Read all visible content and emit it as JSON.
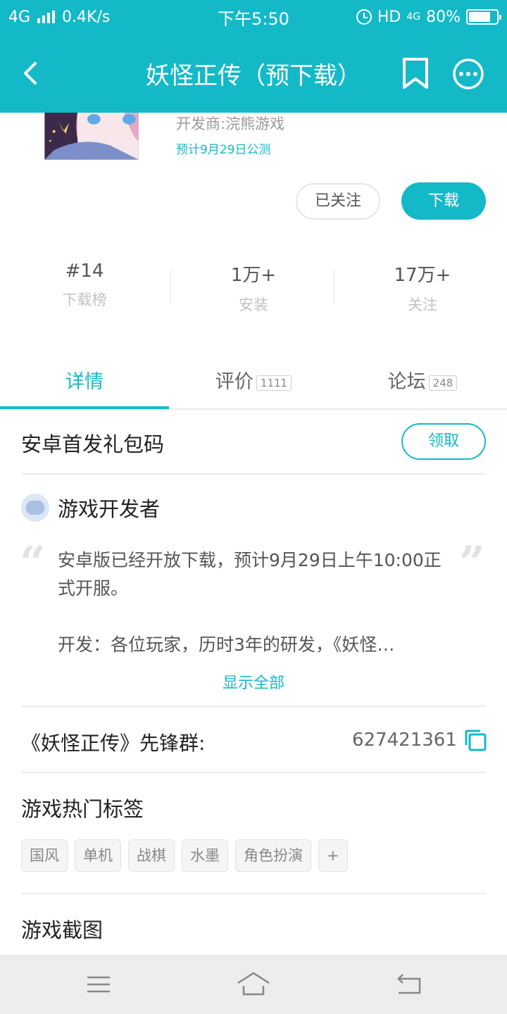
{
  "status_bar": {
    "network": "4G",
    "speed": "0.4K/s",
    "time": "下午5:50",
    "hd": "HD",
    "net2": "4G",
    "battery": "80%",
    "battery_level": 0.8
  },
  "header": {
    "title": "妖怪正传（预下载）",
    "icons": [
      "back-arrow-icon",
      "bookmark-icon",
      "more-icon"
    ]
  },
  "app": {
    "developer": "开发商:浣熊游戏",
    "release": "预计9月29日公测",
    "follow_label": "已关注",
    "download_label": "下载"
  },
  "stats": [
    {
      "value": "#14",
      "label": "下载榜"
    },
    {
      "value": "1万+",
      "label": "安装"
    },
    {
      "value": "17万+",
      "label": "关注"
    }
  ],
  "tabs": [
    {
      "label": "详情",
      "badge": ""
    },
    {
      "label": "评价",
      "badge": "1111"
    },
    {
      "label": "论坛",
      "badge": "248"
    }
  ],
  "gift": {
    "title": "安卓首发礼包码",
    "button": "领取"
  },
  "developer_note": {
    "title": "游戏开发者",
    "line1": "安卓版已经开放下载，预计9月29日上午10:00正式开服。",
    "line2": "开发：各位玩家，历时3年的研发，《妖怪…",
    "show_all": "显示全部"
  },
  "group": {
    "label": "《妖怪正传》先锋群:",
    "number": "627421361"
  },
  "tags_section": {
    "title": "游戏热门标签",
    "tags": [
      "国风",
      "单机",
      "战棋",
      "水墨",
      "角色扮演",
      "+"
    ]
  },
  "screenshots": {
    "title": "游戏截图"
  },
  "colors": {
    "accent": "#14b9c8"
  }
}
